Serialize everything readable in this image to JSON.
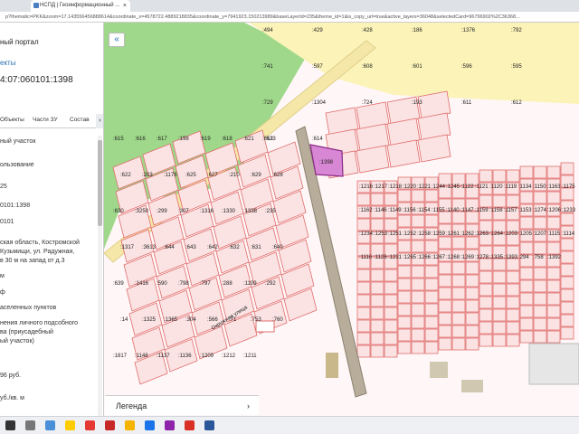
{
  "browser": {
    "tab_title": "НСПД | Геоинформационный ...",
    "tab_close": "×",
    "url": "p?thematic=PKK&zoom=17.143556456888614&coordinate_x=4578722.4889218835&coordinate_y=7941923.150213989&baseLayerId=235&theme_id=1&is_copy_url=true&active_layers=36048&selectedCard=96796902%2C36368..."
  },
  "sidebar": {
    "title": "ный портал",
    "link": "екты",
    "cadastral": "4:07:060101:1398",
    "tabs": [
      "Объекты",
      "Части ЗУ",
      "Состав"
    ],
    "tab_arrow": "›",
    "rows": [
      "ный участок",
      "ользование",
      "25",
      "0101:1398",
      "0101",
      "ская область, Костромской",
      "Кузьмищи, ул. Радужная,",
      "в 30 м на запад от д.3",
      "м",
      "ф",
      "аселенных пунктов",
      "нения личного подсобного",
      "ва (приусадебный",
      "ый участок)",
      "96 руб.",
      "уб./кв. м"
    ]
  },
  "map": {
    "collapse_label": "«",
    "legend_label": "Легенда",
    "legend_arrow": "›",
    "highlight_label": ":1398",
    "street_label": "Окружная улица",
    "parcels": [
      ":494",
      ":429",
      ":428",
      ":186",
      ":1376",
      ":792",
      ":741",
      ":597",
      ":608",
      ":601",
      ":596",
      ":595",
      ":729",
      ":1304",
      ":724",
      ":193",
      ":611",
      ":612",
      ":613",
      ":614",
      ":615",
      ":616",
      ":617",
      ":198",
      ":619",
      ":618",
      ":621",
      ":623",
      ":622",
      ":203",
      ":1178",
      ":625",
      ":627",
      ":210",
      ":629",
      ":628",
      ":630",
      ":3250",
      ":299",
      ":307",
      ":1316",
      ":1330",
      ":1338",
      ":235",
      ":1317",
      ":3613",
      ":644",
      ":643",
      ":642",
      ":632",
      ":631",
      ":640",
      ":639",
      ":1416",
      ":590",
      ":798",
      ":797",
      ":288",
      ":1109",
      ":292",
      ":14",
      ":1325",
      ":1365",
      ":304",
      ":566",
      ":71",
      ":753",
      ":760",
      ":1817",
      ":1148",
      ":1137",
      ":1136",
      ":1209",
      ":1212",
      ":1211",
      ":1216",
      ":1217",
      ":1218",
      ":1220",
      ":1221",
      ":1244",
      ":1245",
      ":1122",
      ":1121",
      ":1120",
      ":1119",
      ":1134",
      ":1150",
      ":1163",
      ":1175",
      ":1162",
      ":1146",
      ":1149",
      ":1156",
      ":1154",
      ":1155",
      ":1140",
      ":1147",
      ":1159",
      ":1158",
      ":1157",
      ":1153",
      ":1274",
      ":1206",
      ":1233",
      ":1234",
      ":1253",
      ":1251",
      ":1252",
      ":1258",
      ":1259",
      ":1261",
      ":1262",
      ":1263",
      ":1264",
      ":1203",
      ":1205",
      ":1207",
      ":1115",
      ":1114",
      ":1116",
      ":1126",
      ":1231",
      ":1265",
      ":1266",
      ":1267",
      ":1268",
      ":1269",
      ":1278",
      ":1335",
      ":1393",
      ":294",
      ":758",
      ":1392"
    ]
  },
  "taskbar": {
    "icons": [
      "start-icon",
      "search-icon",
      "browser-icon",
      "yandex-icon",
      "opera-icon",
      "files-icon",
      "maps-icon",
      "chrome-icon",
      "word-icon"
    ]
  }
}
